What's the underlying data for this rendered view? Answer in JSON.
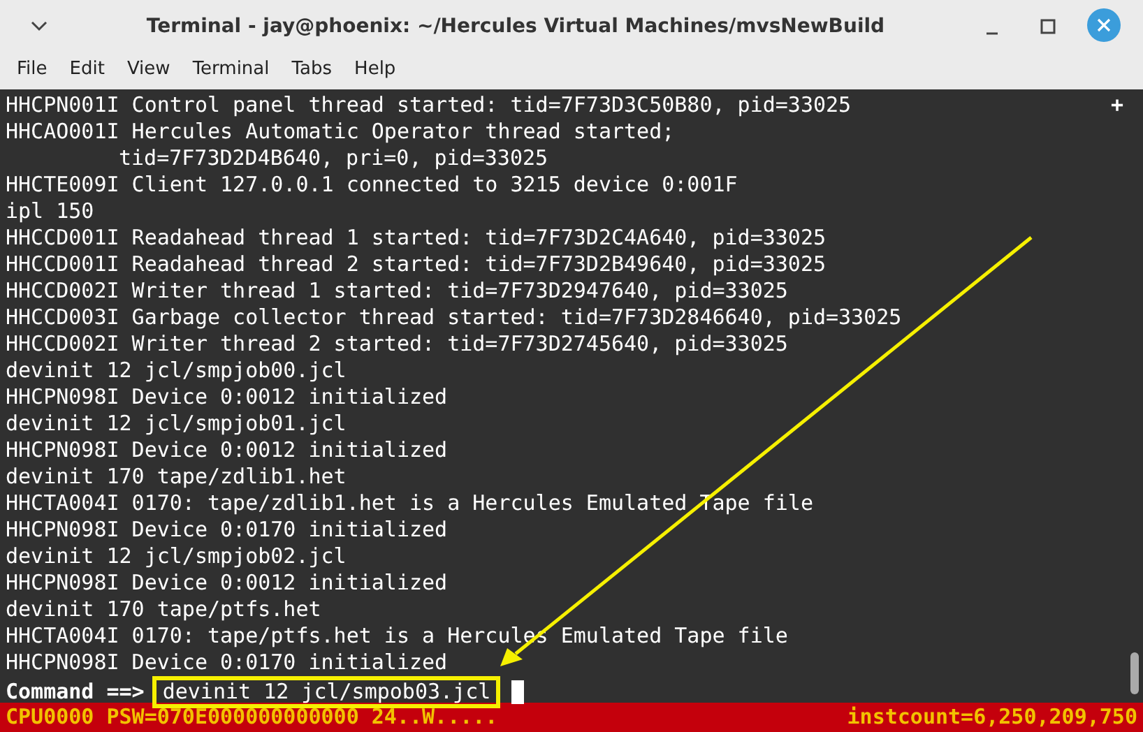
{
  "window": {
    "title": "Terminal - jay@phoenix: ~/Hercules Virtual Machines/mvsNewBuild"
  },
  "menu": [
    "File",
    "Edit",
    "View",
    "Terminal",
    "Tabs",
    "Help"
  ],
  "corner_mark": "+",
  "lines": [
    {
      "kind": "line",
      "text": "HHCPN001I Control panel thread started: tid=7F73D3C50B80, pid=33025"
    },
    {
      "kind": "line",
      "text": "HHCAO001I Hercules Automatic Operator thread started;"
    },
    {
      "kind": "continuation",
      "text": "tid=7F73D2D4B640, pri=0, pid=33025"
    },
    {
      "kind": "line",
      "text": "HHCTE009I Client 127.0.0.1 connected to 3215 device 0:001F"
    },
    {
      "kind": "line",
      "text": "ipl 150"
    },
    {
      "kind": "line",
      "text": "HHCCD001I Readahead thread 1 started: tid=7F73D2C4A640, pid=33025"
    },
    {
      "kind": "line",
      "text": "HHCCD001I Readahead thread 2 started: tid=7F73D2B49640, pid=33025"
    },
    {
      "kind": "line",
      "text": "HHCCD002I Writer thread 1 started: tid=7F73D2947640, pid=33025"
    },
    {
      "kind": "line",
      "text": "HHCCD003I Garbage collector thread started: tid=7F73D2846640, pid=33025"
    },
    {
      "kind": "line",
      "text": "HHCCD002I Writer thread 2 started: tid=7F73D2745640, pid=33025"
    },
    {
      "kind": "line",
      "text": "devinit 12 jcl/smpjob00.jcl"
    },
    {
      "kind": "line",
      "text": "HHCPN098I Device 0:0012 initialized"
    },
    {
      "kind": "line",
      "text": "devinit 12 jcl/smpjob01.jcl"
    },
    {
      "kind": "line",
      "text": "HHCPN098I Device 0:0012 initialized"
    },
    {
      "kind": "line",
      "text": "devinit 170 tape/zdlib1.het"
    },
    {
      "kind": "line",
      "text": "HHCTA004I 0170: tape/zdlib1.het is a Hercules Emulated Tape file"
    },
    {
      "kind": "line",
      "text": "HHCPN098I Device 0:0170 initialized"
    },
    {
      "kind": "line",
      "text": "devinit 12 jcl/smpjob02.jcl"
    },
    {
      "kind": "line",
      "text": "HHCPN098I Device 0:0012 initialized"
    },
    {
      "kind": "line",
      "text": "devinit 170 tape/ptfs.het"
    },
    {
      "kind": "line",
      "text": "HHCTA004I 0170: tape/ptfs.het is a Hercules Emulated Tape file"
    },
    {
      "kind": "line",
      "text": "HHCPN098I Device 0:0170 initialized"
    }
  ],
  "command": {
    "prompt": "Command ==>",
    "value": "devinit 12 jcl/smpob03.jcl"
  },
  "status_bar": {
    "left": "CPU0000 PSW=070E000000000000 24..W.....",
    "right": "instcount=6,250,209,750"
  }
}
